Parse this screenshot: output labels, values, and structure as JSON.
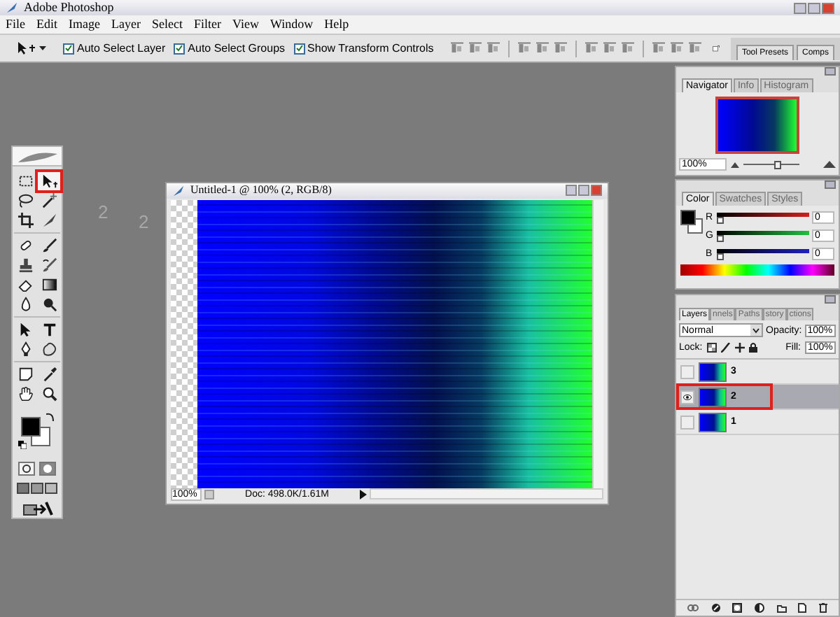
{
  "window": {
    "title": "Adobe Photoshop"
  },
  "menu": [
    "File",
    "Edit",
    "Image",
    "Layer",
    "Select",
    "Filter",
    "View",
    "Window",
    "Help"
  ],
  "options_bar": {
    "checkboxes": [
      {
        "label": "Auto Select Layer",
        "checked": true
      },
      {
        "label": "Auto Select Groups",
        "checked": true
      },
      {
        "label": "Show Transform Controls",
        "checked": true
      }
    ]
  },
  "palette_well": {
    "tabs": [
      "Tool Presets",
      "Comps"
    ]
  },
  "tools": [
    {
      "highlighted": false
    },
    {
      "highlighted": true
    },
    {
      "highlighted": false
    },
    {
      "highlighted": false
    },
    {
      "highlighted": false
    },
    {
      "highlighted": false
    },
    {
      "highlighted": false
    },
    {
      "highlighted": false
    },
    {
      "highlighted": false
    },
    {
      "highlighted": false
    },
    {
      "highlighted": false
    },
    {
      "highlighted": false
    },
    {
      "highlighted": false
    },
    {
      "highlighted": false
    },
    {
      "highlighted": false
    },
    {
      "highlighted": false
    },
    {
      "highlighted": false
    },
    {
      "highlighted": false
    },
    {
      "highlighted": false
    },
    {
      "highlighted": false
    },
    {
      "highlighted": false
    },
    {
      "highlighted": false
    }
  ],
  "workspace_labels": [
    "2",
    "2"
  ],
  "document": {
    "title": "Untitled-1 @ 100% (2, RGB/8)",
    "zoom": "100%",
    "doc_size": "Doc: 498.0K/1.61M"
  },
  "navigator": {
    "tabs": [
      {
        "label": "Navigator",
        "selected": true
      },
      {
        "label": "Info",
        "selected": false
      },
      {
        "label": "Histogram",
        "selected": false
      }
    ],
    "zoom": "100%",
    "level": 0.6
  },
  "color": {
    "tabs": [
      {
        "label": "Color",
        "selected": true
      },
      {
        "label": "Swatches",
        "selected": false
      },
      {
        "label": "Styles",
        "selected": false
      }
    ],
    "channels": [
      {
        "label": "R",
        "value": "0",
        "level": 0
      },
      {
        "label": "G",
        "value": "0",
        "level": 0
      },
      {
        "label": "B",
        "value": "0",
        "level": 0
      }
    ]
  },
  "layers": {
    "tabs": [
      {
        "label": "Layers",
        "selected": true
      },
      {
        "label": "nnels",
        "selected": false
      },
      {
        "label": "Paths",
        "selected": false
      },
      {
        "label": "story",
        "selected": false
      },
      {
        "label": "ctions",
        "selected": false
      }
    ],
    "blend_mode": "Normal",
    "opacity_label": "Opacity:",
    "opacity": "100%",
    "lock_label": "Lock:",
    "fill_label": "Fill:",
    "fill": "100%",
    "items": [
      {
        "name": "3",
        "visible": false,
        "selected": false,
        "highlighted": false
      },
      {
        "name": "2",
        "visible": true,
        "selected": true,
        "highlighted": true
      },
      {
        "name": "1",
        "visible": false,
        "selected": false,
        "highlighted": false
      }
    ]
  }
}
